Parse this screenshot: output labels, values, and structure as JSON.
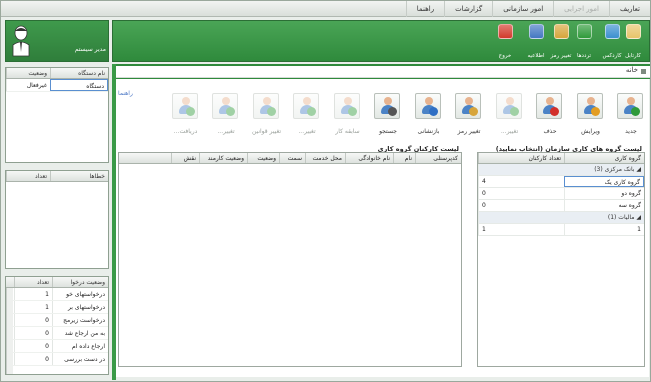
{
  "top_menu": {
    "items": [
      {
        "label": "تعاریف",
        "enabled": true
      },
      {
        "label": "امور اجرایی",
        "enabled": false
      },
      {
        "label": "امور سازمانی",
        "enabled": true
      },
      {
        "label": "گزارشات",
        "enabled": true
      },
      {
        "label": "راهنما",
        "enabled": true
      }
    ]
  },
  "user": {
    "name": "مدیر سیستم",
    "icon": "user-avatar-icon"
  },
  "toolbar": {
    "buttons": [
      {
        "label": "کارتابل",
        "icon": "inbox-icon",
        "color": "#e7c46a"
      },
      {
        "label": "کاردکس",
        "icon": "cardex-icon",
        "color": "#3b8fcf"
      },
      {
        "label": "ترددها",
        "icon": "globe-icon",
        "color": "#2f9a3a"
      },
      {
        "label": "تغییر رمز",
        "icon": "key-icon",
        "color": "#d7a53b"
      },
      {
        "label": "اطلاعیه",
        "icon": "notice-icon",
        "color": "#4477c2"
      },
      {
        "label": "خروج",
        "icon": "exit-icon",
        "color": "#d23a2c"
      }
    ]
  },
  "tab": {
    "label": "خانه"
  },
  "quick_actions": {
    "label": "راهنما",
    "items": [
      {
        "label": "جدید",
        "badge": "#2e9a3a",
        "enabled": true
      },
      {
        "label": "ویرایش",
        "badge": "#e39d22",
        "enabled": true
      },
      {
        "label": "حذف",
        "badge": "#d2302a",
        "enabled": true
      },
      {
        "label": "تغییر...",
        "badge": "#2e9a3a",
        "enabled": false
      },
      {
        "label": "تغییر رمز",
        "badge": "#d7a53b",
        "enabled": true
      },
      {
        "label": "بازنشانی",
        "badge": "#2f6fc4",
        "enabled": true
      },
      {
        "label": "جستجو",
        "badge": "#555555",
        "enabled": true
      },
      {
        "label": "سابقه کار",
        "badge": "#2e9a3a",
        "enabled": false
      },
      {
        "label": "تغییر...",
        "badge": "#2e9a3a",
        "enabled": false
      },
      {
        "label": "تغییر قوانین",
        "badge": "#2e9a3a",
        "enabled": false
      },
      {
        "label": "تغییر...",
        "badge": "#2e9a3a",
        "enabled": false
      },
      {
        "label": "دریافت...",
        "badge": "#2e9a3a",
        "enabled": false
      }
    ]
  },
  "devices_panel": {
    "columns": [
      "نام دستگاه",
      "وضعیت"
    ],
    "rows": [
      [
        "دستگاه",
        "غیرفعال"
      ]
    ]
  },
  "errors_panel": {
    "columns": [
      "خطاها",
      "تعداد"
    ]
  },
  "requests_panel": {
    "columns": [
      "وضعیت درخوا",
      "تعداد"
    ],
    "rows": [
      [
        "درخواستهای خو",
        "1"
      ],
      [
        "درخواستهای بر",
        "1"
      ],
      [
        "درخواست زیرمج",
        "0"
      ],
      [
        "به من ارجاع شد",
        "0"
      ],
      [
        "ارجاع داده ام",
        "0"
      ],
      [
        "در دست بررسی",
        "0"
      ]
    ]
  },
  "groups_grid": {
    "title": "لیست گروه های کاری سازمان (انتخاب نمایید)",
    "columns": [
      "گروه کاری",
      "تعداد کارکنان"
    ],
    "rows": [
      {
        "type": "group",
        "name": "بانک مرکزی (3)"
      },
      {
        "type": "row",
        "name": "گروه کاری یک",
        "count": "4"
      },
      {
        "type": "row",
        "name": "گروه دو",
        "count": "0"
      },
      {
        "type": "row",
        "name": "گروه سه",
        "count": "0"
      },
      {
        "type": "group",
        "name": "مالیات (1)"
      },
      {
        "type": "row",
        "name": "1",
        "count": "1"
      }
    ]
  },
  "staff_grid": {
    "title": "لیست کارکنان گروه کاری",
    "columns": [
      "کدپرسنلی",
      "نام",
      "نام خانوادگی",
      "محل خدمت",
      "سمت",
      "وضعیت",
      "وضعیت کارمند",
      "نقش"
    ]
  }
}
